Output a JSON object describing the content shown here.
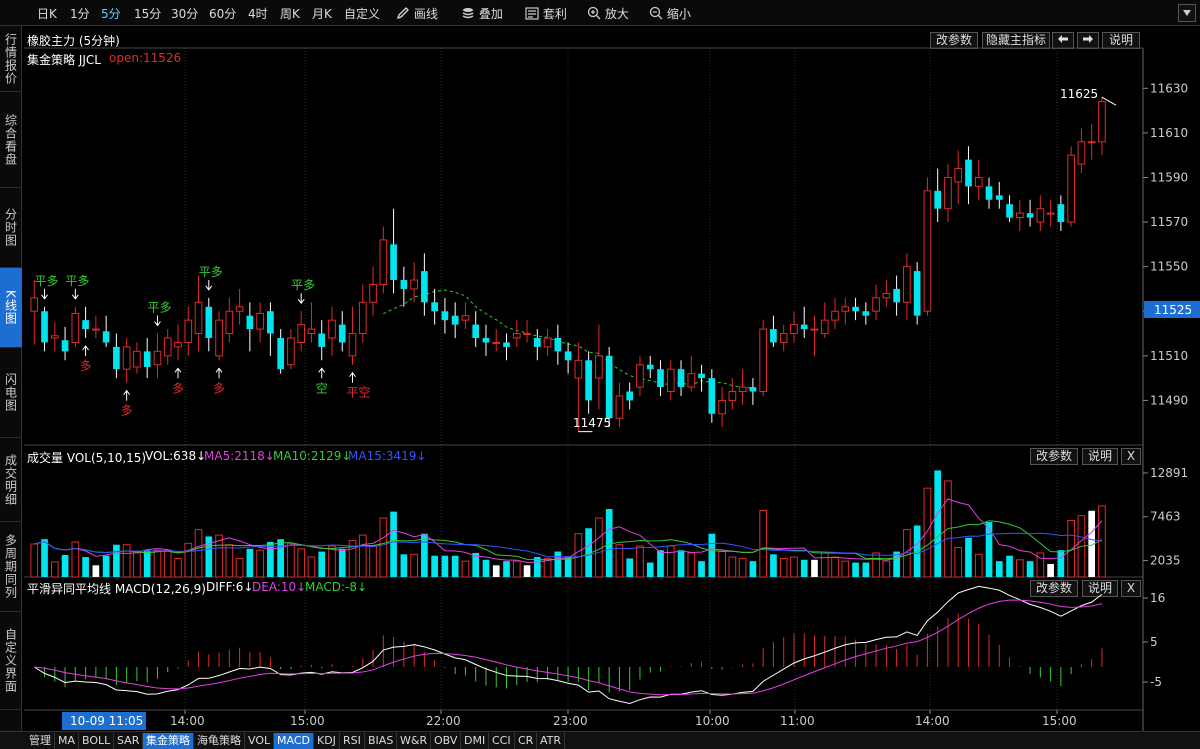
{
  "colors": {
    "up": "#e02a2a",
    "down": "#00e5ee",
    "white": "#ffffff",
    "magenta": "#e040e0",
    "green": "#33cc33",
    "blue": "#3355ff",
    "axis": "#888888",
    "highlight": "#1c6fd0"
  },
  "toolbar": {
    "periods": [
      "日K",
      "1分",
      "5分",
      "15分",
      "30分",
      "60分",
      "4时",
      "周K",
      "月K",
      "自定义"
    ],
    "active_period": "5分",
    "tools": [
      {
        "icon": "pencil-icon",
        "label": "画线"
      },
      {
        "icon": "layers-icon",
        "label": "叠加"
      },
      {
        "icon": "arbitrage-icon",
        "label": "套利"
      },
      {
        "icon": "zoom-in-icon",
        "label": "放大"
      },
      {
        "icon": "zoom-out-icon",
        "label": "缩小"
      }
    ]
  },
  "leftnav": [
    "行情报价",
    "综合看盘",
    "分时图",
    "K线图",
    "闪电图",
    "成交明细",
    "多周期同列",
    "自定义界面"
  ],
  "leftnav_active": "K线图",
  "main": {
    "title": "橡胶主力 (5分钟)",
    "strategy": "集金策略 JJCL",
    "open_label": "open:11526",
    "buttons": [
      "改参数",
      "隐藏主指标",
      "说明"
    ],
    "current_price": "11525",
    "hi_label": "11625",
    "lo_label": "11475",
    "yticks": [
      "11630",
      "11610",
      "11590",
      "11570",
      "11550",
      "11530",
      "11510",
      "11490"
    ],
    "signals": [
      {
        "text": "平多",
        "color": "green"
      },
      {
        "text": "平多",
        "color": "green"
      },
      {
        "text": "多",
        "color": "red"
      },
      {
        "text": "多",
        "color": "red"
      },
      {
        "text": "平多",
        "color": "green"
      },
      {
        "text": "多",
        "color": "red"
      },
      {
        "text": "平多",
        "color": "green"
      },
      {
        "text": "多",
        "color": "red"
      },
      {
        "text": "平多",
        "color": "green"
      },
      {
        "text": "空",
        "color": "green"
      },
      {
        "text": "平空",
        "color": "red"
      }
    ]
  },
  "volume": {
    "header": "成交量 VOL(5,10,15)",
    "vol": "VOL:638↓",
    "ma5": "MA5:2118↓",
    "ma10": "MA10:2129↓",
    "ma15": "MA15:3419↓",
    "buttons": [
      "改参数",
      "说明",
      "X"
    ],
    "yticks": [
      "12891",
      "7463",
      "2035"
    ]
  },
  "macd": {
    "header": "平滑异同平均线 MACD(12,26,9)",
    "diff": "DIFF:6↓",
    "dea": "DEA:10↓",
    "macd": "MACD:-8↓",
    "buttons": [
      "改参数",
      "说明",
      "X"
    ],
    "yticks": [
      "16",
      "5",
      "-5"
    ]
  },
  "xaxis": {
    "cursor_label": "10-09 11:05",
    "ticks": [
      "14:00",
      "15:00",
      "22:00",
      "23:00",
      "10:00",
      "11:00",
      "14:00",
      "15:00"
    ]
  },
  "bottombar": {
    "items": [
      "管理",
      "MA",
      "BOLL",
      "SAR",
      "集金策略",
      "海龟策略",
      "VOL",
      "MACD",
      "KDJ",
      "RSI",
      "BIAS",
      "W&R",
      "OBV",
      "DMI",
      "CCI",
      "CR",
      "ATR"
    ],
    "active": [
      "集金策略",
      "MACD"
    ]
  },
  "chart_data": {
    "type": "candlestick",
    "title": "橡胶主力 (5分钟)",
    "ylim": [
      11470,
      11640
    ],
    "candles": [
      [
        11530,
        11536,
        11544,
        11515
      ],
      [
        11530,
        11516,
        11532,
        11512
      ],
      [
        11518,
        11519,
        11525,
        11512
      ],
      [
        11517,
        11512,
        11523,
        11508
      ],
      [
        11516,
        11529,
        11532,
        11514
      ],
      [
        11526,
        11522,
        11532,
        11518
      ],
      [
        11522,
        11522,
        11528,
        11518
      ],
      [
        11521,
        11516,
        11528,
        11514
      ],
      [
        11514,
        11504,
        11520,
        11500
      ],
      [
        11504,
        11514,
        11518,
        11498
      ],
      [
        11505,
        11512,
        11516,
        11502
      ],
      [
        11512,
        11505,
        11518,
        11500
      ],
      [
        11506,
        11512,
        11520,
        11500
      ],
      [
        11510,
        11518,
        11522,
        11506
      ],
      [
        11514,
        11516,
        11524,
        11508
      ],
      [
        11516,
        11526,
        11532,
        11510
      ],
      [
        11520,
        11534,
        11546,
        11512
      ],
      [
        11532,
        11518,
        11536,
        11512
      ],
      [
        11510,
        11526,
        11530,
        11508
      ],
      [
        11520,
        11530,
        11536,
        11516
      ],
      [
        11530,
        11532,
        11540,
        11524
      ],
      [
        11528,
        11522,
        11534,
        11512
      ],
      [
        11522,
        11529,
        11534,
        11516
      ],
      [
        11530,
        11520,
        11534,
        11510
      ],
      [
        11518,
        11504,
        11522,
        11502
      ],
      [
        11506,
        11518,
        11522,
        11504
      ],
      [
        11516,
        11524,
        11530,
        11512
      ],
      [
        11520,
        11522,
        11534,
        11516
      ],
      [
        11520,
        11514,
        11526,
        11508
      ],
      [
        11518,
        11526,
        11532,
        11510
      ],
      [
        11524,
        11516,
        11530,
        11512
      ],
      [
        11510,
        11520,
        11532,
        11506
      ],
      [
        11520,
        11534,
        11542,
        11516
      ],
      [
        11534,
        11542,
        11550,
        11528
      ],
      [
        11542,
        11562,
        11568,
        11538
      ],
      [
        11560,
        11544,
        11576,
        11538
      ],
      [
        11544,
        11540,
        11550,
        11532
      ],
      [
        11540,
        11544,
        11552,
        11534
      ],
      [
        11548,
        11534,
        11556,
        11528
      ],
      [
        11534,
        11530,
        11540,
        11524
      ],
      [
        11530,
        11526,
        11536,
        11520
      ],
      [
        11528,
        11524,
        11534,
        11518
      ],
      [
        11526,
        11528,
        11534,
        11522
      ],
      [
        11524,
        11518,
        11530,
        11514
      ],
      [
        11518,
        11516,
        11524,
        11510
      ],
      [
        11516,
        11516,
        11522,
        11512
      ],
      [
        11516,
        11514,
        11520,
        11508
      ],
      [
        11518,
        11520,
        11526,
        11514
      ],
      [
        11520,
        11520,
        11526,
        11516
      ],
      [
        11518,
        11514,
        11522,
        11508
      ],
      [
        11514,
        11518,
        11522,
        11510
      ],
      [
        11518,
        11512,
        11524,
        11506
      ],
      [
        11512,
        11508,
        11516,
        11502
      ],
      [
        11500,
        11508,
        11516,
        11476
      ],
      [
        11508,
        11490,
        11512,
        11484
      ],
      [
        11500,
        11510,
        11524,
        11486
      ],
      [
        11510,
        11482,
        11514,
        11478
      ],
      [
        11482,
        11492,
        11498,
        11478
      ],
      [
        11494,
        11490,
        11498,
        11486
      ],
      [
        11496,
        11506,
        11510,
        11492
      ],
      [
        11506,
        11504,
        11510,
        11500
      ],
      [
        11504,
        11496,
        11508,
        11492
      ],
      [
        11494,
        11504,
        11508,
        11490
      ],
      [
        11504,
        11496,
        11508,
        11492
      ],
      [
        11496,
        11502,
        11510,
        11494
      ],
      [
        11502,
        11500,
        11506,
        11494
      ],
      [
        11500,
        11484,
        11504,
        11480
      ],
      [
        11484,
        11490,
        11496,
        11478
      ],
      [
        11490,
        11494,
        11500,
        11486
      ],
      [
        11494,
        11496,
        11504,
        11488
      ],
      [
        11496,
        11494,
        11500,
        11488
      ],
      [
        11494,
        11522,
        11526,
        11492
      ],
      [
        11522,
        11516,
        11528,
        11514
      ],
      [
        11516,
        11520,
        11524,
        11512
      ],
      [
        11520,
        11524,
        11530,
        11516
      ],
      [
        11524,
        11522,
        11532,
        11518
      ],
      [
        11522,
        11522,
        11528,
        11510
      ],
      [
        11520,
        11526,
        11534,
        11518
      ],
      [
        11526,
        11530,
        11536,
        11522
      ],
      [
        11530,
        11532,
        11536,
        11524
      ],
      [
        11532,
        11530,
        11536,
        11526
      ],
      [
        11530,
        11528,
        11534,
        11524
      ],
      [
        11530,
        11536,
        11542,
        11526
      ],
      [
        11536,
        11538,
        11544,
        11532
      ],
      [
        11540,
        11534,
        11546,
        11528
      ],
      [
        11534,
        11550,
        11556,
        11526
      ],
      [
        11548,
        11528,
        11552,
        11524
      ],
      [
        11530,
        11584,
        11590,
        11528
      ],
      [
        11584,
        11576,
        11594,
        11570
      ],
      [
        11576,
        11590,
        11596,
        11570
      ],
      [
        11588,
        11594,
        11602,
        11578
      ],
      [
        11598,
        11586,
        11604,
        11578
      ],
      [
        11586,
        11590,
        11598,
        11580
      ],
      [
        11586,
        11580,
        11590,
        11576
      ],
      [
        11582,
        11580,
        11588,
        11576
      ],
      [
        11578,
        11572,
        11582,
        11570
      ],
      [
        11572,
        11574,
        11580,
        11566
      ],
      [
        11574,
        11572,
        11580,
        11568
      ],
      [
        11570,
        11576,
        11582,
        11566
      ],
      [
        11574,
        11574,
        11580,
        11568
      ],
      [
        11578,
        11570,
        11582,
        11566
      ],
      [
        11570,
        11600,
        11604,
        11568
      ],
      [
        11596,
        11606,
        11612,
        11592
      ],
      [
        11606,
        11606,
        11614,
        11598
      ],
      [
        11606,
        11624,
        11626,
        11600
      ]
    ]
  }
}
